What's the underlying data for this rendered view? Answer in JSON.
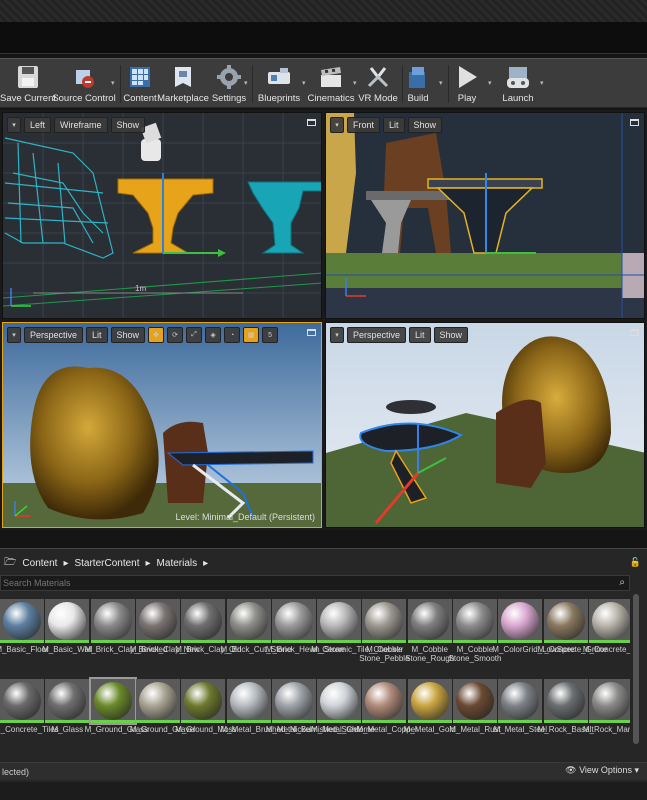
{
  "toolbar": {
    "buttons": [
      {
        "label": "Save Current",
        "icon": "floppy-disk-icon"
      },
      {
        "label": "Source Control",
        "icon": "source-control-icon"
      },
      {
        "label": "Content",
        "icon": "content-grid-icon"
      },
      {
        "label": "Marketplace",
        "icon": "marketplace-icon"
      },
      {
        "label": "Settings",
        "icon": "gear-icon"
      },
      {
        "label": "Blueprints",
        "icon": "blueprint-icon"
      },
      {
        "label": "Cinematics",
        "icon": "clapper-icon"
      },
      {
        "label": "VR Mode",
        "icon": "vr-icon"
      },
      {
        "label": "Build",
        "icon": "build-icon"
      },
      {
        "label": "Play",
        "icon": "play-icon"
      },
      {
        "label": "Launch",
        "icon": "gamepad-icon"
      }
    ]
  },
  "viewports": {
    "left": {
      "view": "Left",
      "mode": "Wireframe",
      "show": "Show",
      "scale_label": "1m"
    },
    "front": {
      "view": "Front",
      "mode": "Lit",
      "show": "Show"
    },
    "perspective": {
      "view": "Perspective",
      "mode": "Lit",
      "show": "Show",
      "grid_value": "5",
      "level_text": "Level:  Minimal_Default (Persistent)"
    },
    "perspective2": {
      "view": "Perspective",
      "mode": "Lit",
      "show": "Show"
    }
  },
  "content_browser": {
    "path": [
      "Content",
      "StarterContent",
      "Materials"
    ],
    "search_placeholder": "Search Materials",
    "row1": [
      {
        "name": "M_Basic_Floor",
        "color": "#5d7fa0"
      },
      {
        "name": "M_Basic_Wall",
        "color": "#e8e8e8"
      },
      {
        "name": "M_Brick_Clay_Beveled",
        "color": "#8a8a8a"
      },
      {
        "name": "M_Brick_Clay_New",
        "color": "#7a7371"
      },
      {
        "name": "M_Brick_Clay_Old",
        "color": "#6f6f6f"
      },
      {
        "name": "M_Brick_Cut_Stone",
        "color": "#8e8e8a"
      },
      {
        "name": "M_Brick_Hewn_Stone",
        "color": "#9a9a9a"
      },
      {
        "name": "M_Ceramic_Tile_Checker",
        "color": "#b9b9b9"
      },
      {
        "name": "M_Cobble Stone_Pebble",
        "color": "#9c9890"
      },
      {
        "name": "M_Cobble Stone_Rough",
        "color": "#7f7f7f"
      },
      {
        "name": "M_Cobble Stone_Smooth",
        "color": "#8c8c8c"
      },
      {
        "name": "M_ColorGrid_LowSpec",
        "color": "#d9a7d0"
      },
      {
        "name": "M_Concrete_Grime",
        "color": "#8a7860"
      },
      {
        "name": "M_Concrete_Panels",
        "color": "#b8b4aa"
      }
    ],
    "row2": [
      {
        "name": "M_Concrete_Tiles",
        "color": "#6a6a6a"
      },
      {
        "name": "M_Glass",
        "color": "#6f6f6f"
      },
      {
        "name": "M_Ground_Grass",
        "color": "#6a8a2a"
      },
      {
        "name": "M_Ground_Gravel",
        "color": "#a9a594"
      },
      {
        "name": "M_Ground_Moss",
        "color": "#6d7a2e"
      },
      {
        "name": "M_Metal_Brushed_Nickel",
        "color": "#b7bcc2"
      },
      {
        "name": "M_Metal_Burnished_Steel",
        "color": "#9ea3a8"
      },
      {
        "name": "M_Metal_Chrome",
        "color": "#cfd3d8"
      },
      {
        "name": "M_Metal_Copper",
        "color": "#b08a7a"
      },
      {
        "name": "M_Metal_Gold",
        "color": "#c9a440"
      },
      {
        "name": "M_Metal_Rust",
        "color": "#6b4a32"
      },
      {
        "name": "M_Metal_Steel",
        "color": "#7d8288"
      },
      {
        "name": "M_Rock_Basalt",
        "color": "#6a6e70"
      },
      {
        "name": "M_Rock_Marble_Polished",
        "color": "#8a8a88"
      }
    ],
    "selected": "M_Ground_Grass",
    "status": "lected)",
    "view_options": "View Options"
  }
}
